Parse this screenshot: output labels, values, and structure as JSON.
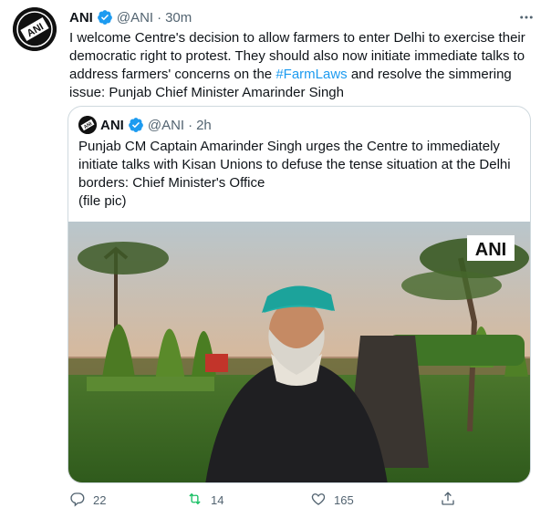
{
  "tweet": {
    "author_name": "ANI",
    "handle": "@ANI",
    "separator": "·",
    "time": "30m",
    "avatar_text": "ANI",
    "text_before": "I welcome Centre's decision to allow farmers to enter Delhi to exercise their democratic right to protest. They should also now initiate immediate talks to address farmers' concerns on the ",
    "hashtag": "#FarmLaws",
    "text_after": " and resolve the simmering issue: Punjab Chief Minister Amarinder Singh"
  },
  "quoted": {
    "author_name": "ANI",
    "handle": "@ANI",
    "separator": "·",
    "time": "2h",
    "lines": [
      "Punjab CM Captain Amarinder Singh urges the Centre to immediately initiate talks with Kisan Unions to defuse the tense situation at the Delhi borders: Chief Minister's Office",
      "(file pic)"
    ],
    "media_watermark": "ANI"
  },
  "actions": {
    "replies": "22",
    "retweets": "14",
    "likes": "165"
  },
  "colors": {
    "accent": "#1d9bf0",
    "secondary_text": "#536471",
    "border": "#cfd9de",
    "retweet_icon": "#17bf63"
  }
}
